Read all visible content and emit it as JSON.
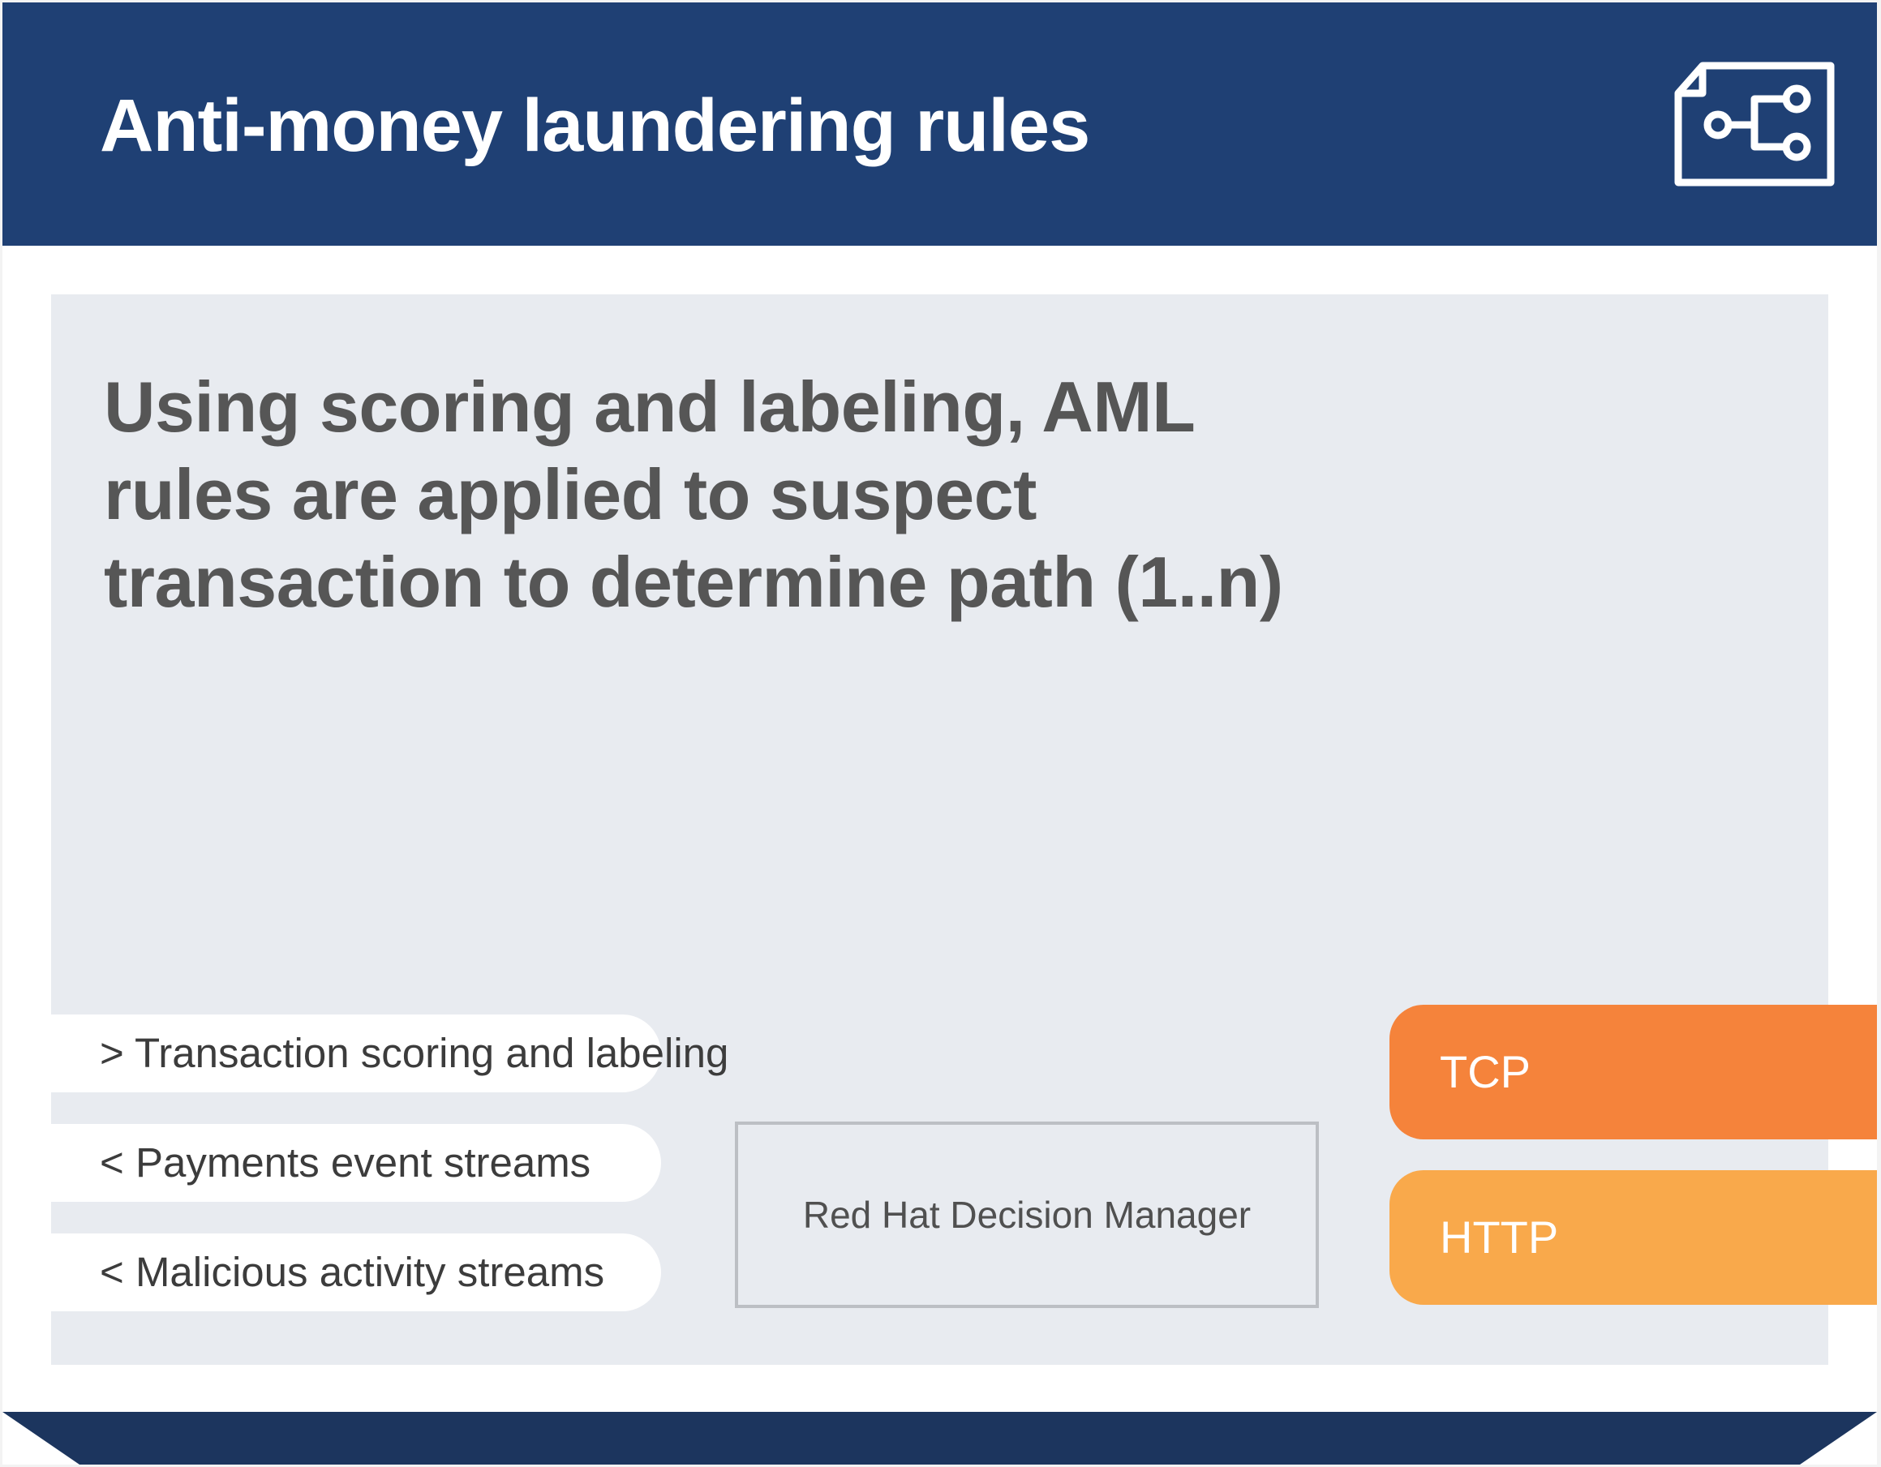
{
  "header": {
    "title": "Anti-money laundering rules",
    "icon": "flow-document-icon"
  },
  "headline": "Using scoring and labeling, AML rules are applied to suspect transaction to determine  path (1..n)",
  "streams": [
    {
      "label": "> Transaction scoring and labeling"
    },
    {
      "label": "< Payments event streams"
    },
    {
      "label": "< Malicious activity streams"
    }
  ],
  "component": {
    "label": "Red Hat Decision Manager"
  },
  "protocols": [
    {
      "label": "TCP"
    },
    {
      "label": "HTTP"
    }
  ],
  "colors": {
    "header": "#1f4074",
    "panel": "#e8ebf0",
    "tcp": "#f5833b",
    "http": "#f9a94b",
    "footer": "#1c355e"
  }
}
